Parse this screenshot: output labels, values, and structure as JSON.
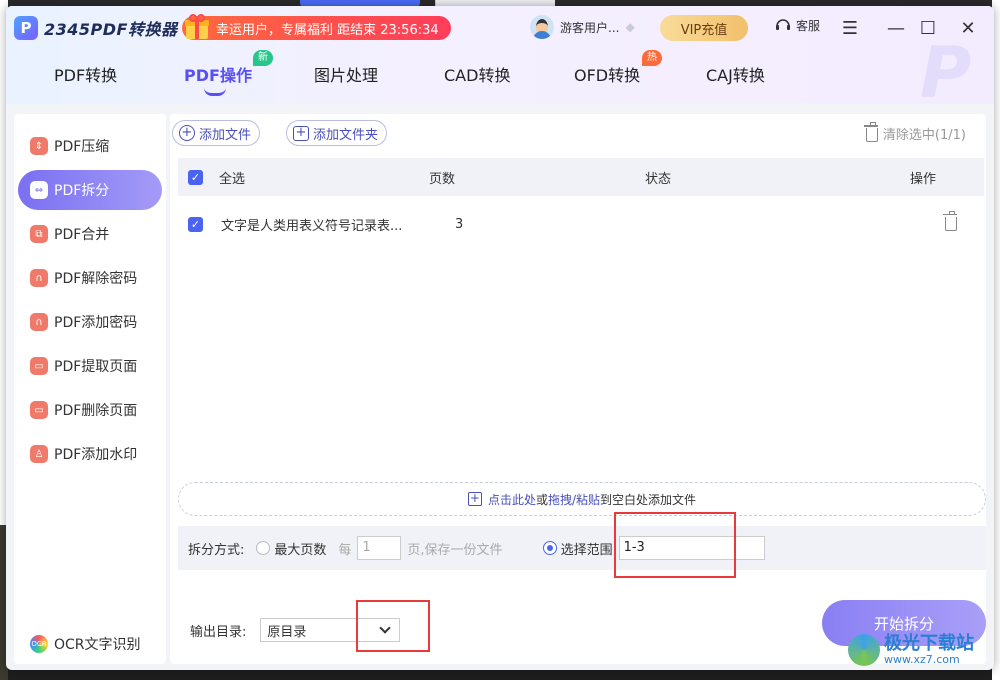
{
  "app": {
    "logo_letter": "P",
    "logo_text": "2345PDF转换器"
  },
  "promo": {
    "text": "幸运用户，专属福利 距结束 23:56:34"
  },
  "user": {
    "name": "游客用户..."
  },
  "vip_label": "VIP充值",
  "service_label": "客服",
  "tabs": [
    {
      "label": "PDF转换"
    },
    {
      "label": "PDF操作",
      "badge": "新"
    },
    {
      "label": "图片处理"
    },
    {
      "label": "CAD转换"
    },
    {
      "label": "OFD转换",
      "badge": "热"
    },
    {
      "label": "CAJ转换"
    }
  ],
  "sidebar": {
    "items": [
      {
        "label": "PDF压缩",
        "icon": "compress-icon"
      },
      {
        "label": "PDF拆分",
        "icon": "split-icon"
      },
      {
        "label": "PDF合并",
        "icon": "merge-icon"
      },
      {
        "label": "PDF解除密码",
        "icon": "unlock-icon"
      },
      {
        "label": "PDF添加密码",
        "icon": "lock-icon"
      },
      {
        "label": "PDF提取页面",
        "icon": "extract-icon"
      },
      {
        "label": "PDF删除页面",
        "icon": "delete-page-icon"
      },
      {
        "label": "PDF添加水印",
        "icon": "watermark-icon"
      }
    ],
    "ocr_label": "OCR文字识别"
  },
  "toolbar": {
    "add_file": "添加文件",
    "add_folder": "添加文件夹",
    "clear_selected": "清除选中(1/1)"
  },
  "table": {
    "headers": {
      "select_all": "全选",
      "pages": "页数",
      "status": "状态",
      "action": "操作"
    },
    "rows": [
      {
        "name": "文字是人类用表义符号记录表...",
        "pages": "3",
        "status": ""
      }
    ]
  },
  "drop_zone": {
    "click_text": "点击此处",
    "or_text": "或",
    "drag_text": "拖拽/粘贴",
    "tail_text": "到空白处添加文件"
  },
  "split": {
    "label": "拆分方式:",
    "max_pages_label": "最大页数",
    "every_label": "每",
    "every_value": "1",
    "page_suffix": "页,保存一份文件",
    "range_label": "选择范围",
    "range_value": "1-3"
  },
  "output": {
    "label": "输出目录:",
    "value": "原目录"
  },
  "start_button": "开始拆分",
  "watermark": {
    "cn": "极光下载站",
    "url": "www.xz7.com"
  },
  "colors": {
    "accent": "#5a4ff2",
    "highlight": "#e53b3b"
  }
}
